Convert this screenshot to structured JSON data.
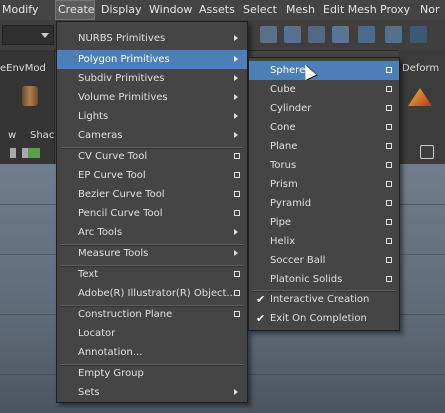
{
  "menubar": {
    "items": [
      "Modify",
      "Create",
      "Display",
      "Window",
      "Assets",
      "Select",
      "Mesh",
      "Edit Mesh",
      "Proxy",
      "Nor"
    ]
  },
  "background": {
    "shelf_tab_left": "eEnvMod",
    "shelf_tab_right": "Deform",
    "panel_labels": [
      "w",
      "Shac"
    ]
  },
  "create_menu": {
    "items": [
      {
        "label": "NURBS Primitives",
        "type": "submenu"
      },
      {
        "label": "Polygon Primitives",
        "type": "submenu",
        "highlighted": true
      },
      {
        "label": "Subdiv Primitives",
        "type": "submenu"
      },
      {
        "label": "Volume Primitives",
        "type": "submenu"
      },
      {
        "label": "Lights",
        "type": "submenu"
      },
      {
        "label": "Cameras",
        "type": "submenu"
      },
      {
        "label": "CV Curve Tool",
        "type": "option"
      },
      {
        "label": "EP Curve Tool",
        "type": "option"
      },
      {
        "label": "Bezier Curve Tool",
        "type": "option"
      },
      {
        "label": "Pencil Curve Tool",
        "type": "option"
      },
      {
        "label": "Arc Tools",
        "type": "submenu"
      },
      {
        "label": "Measure Tools",
        "type": "submenu"
      },
      {
        "label": "Text",
        "type": "option"
      },
      {
        "label": "Adobe(R) Illustrator(R) Object...",
        "type": "option"
      },
      {
        "label": "Construction Plane",
        "type": "option"
      },
      {
        "label": "Locator",
        "type": "plain"
      },
      {
        "label": "Annotation...",
        "type": "plain"
      },
      {
        "label": "Empty Group",
        "type": "plain"
      },
      {
        "label": "Sets",
        "type": "submenu"
      }
    ]
  },
  "polygon_menu": {
    "items": [
      {
        "label": "Sphere",
        "type": "option",
        "highlighted": true
      },
      {
        "label": "Cube",
        "type": "option"
      },
      {
        "label": "Cylinder",
        "type": "option"
      },
      {
        "label": "Cone",
        "type": "option"
      },
      {
        "label": "Plane",
        "type": "option"
      },
      {
        "label": "Torus",
        "type": "option"
      },
      {
        "label": "Prism",
        "type": "option"
      },
      {
        "label": "Pyramid",
        "type": "option"
      },
      {
        "label": "Pipe",
        "type": "option"
      },
      {
        "label": "Helix",
        "type": "option"
      },
      {
        "label": "Soccer Ball",
        "type": "option"
      },
      {
        "label": "Platonic Solids",
        "type": "option"
      },
      {
        "label": "Interactive Creation",
        "type": "check",
        "checked": true
      },
      {
        "label": "Exit On Completion",
        "type": "check",
        "checked": true
      }
    ]
  },
  "colors": {
    "highlight": "#4c7fb8",
    "menu_bg": "#454545",
    "app_bg": "#444444"
  }
}
